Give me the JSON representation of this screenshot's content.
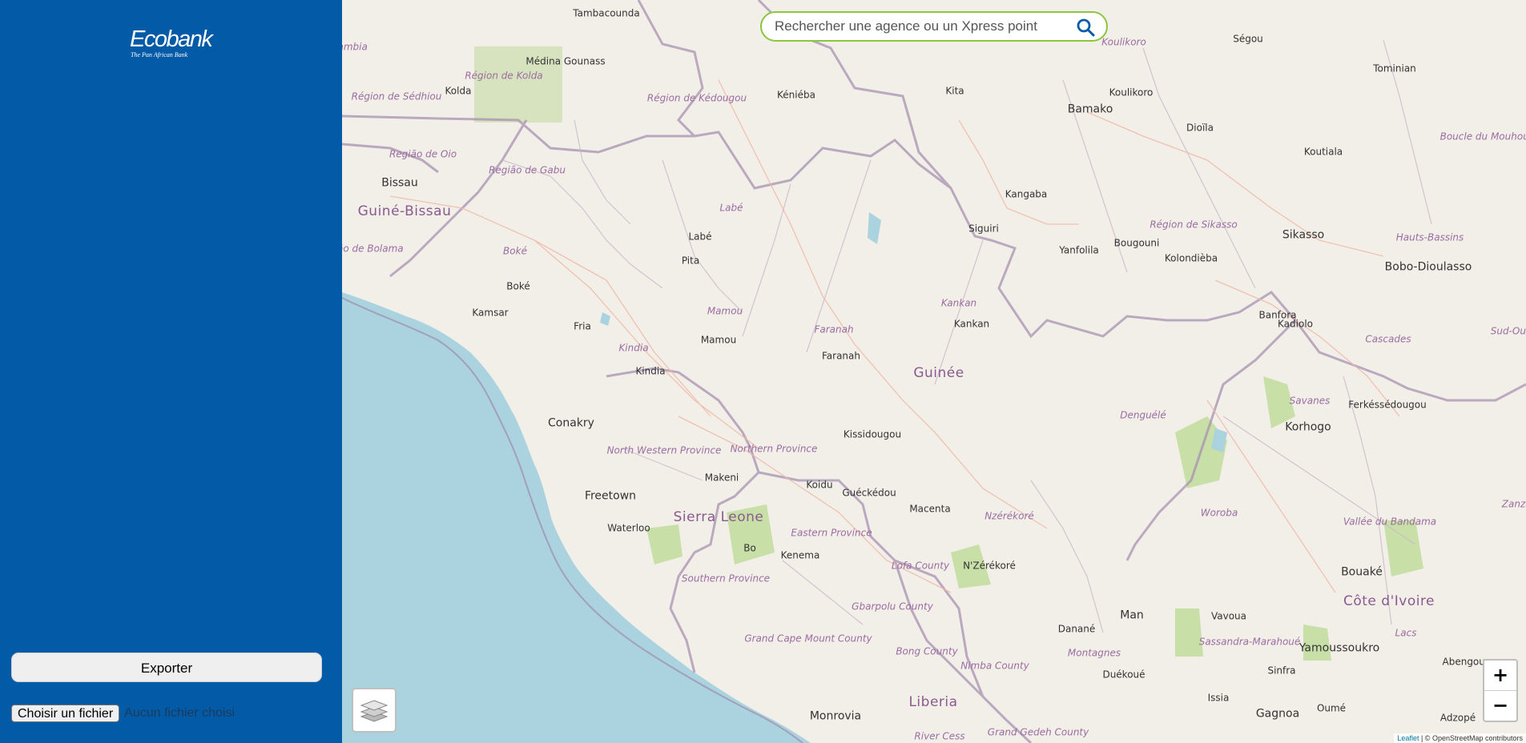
{
  "sidebar": {
    "logo_name": "Ecobank",
    "logo_tagline": "The Pan African Bank",
    "export_label": "Exporter",
    "file_button_label": "Choisir un fichier",
    "file_status": "Aucun fichier choisi"
  },
  "search": {
    "placeholder": "Rechercher une agence ou un Xpress point"
  },
  "map": {
    "zoom_in": "+",
    "zoom_out": "−",
    "attribution_link": "Leaflet",
    "attribution_text": "| © OpenStreetMap contributors",
    "countries": [
      "Guinée",
      "Sierra Leone",
      "Liberia",
      "Côte d'Ivoire",
      "Guiné-Bissau"
    ],
    "capitals": [
      "Bissau",
      "Conakry",
      "Freetown",
      "Monrovia",
      "Bamako",
      "Yamoussoukro"
    ],
    "cities": [
      "Tambacounda",
      "Médina Gounass",
      "Kolda",
      "Kéniéba",
      "Kita",
      "Ségou",
      "Koulikoro",
      "Tominian",
      "Dioïla",
      "Koutiala",
      "Kangaba",
      "Siguiri",
      "Bougouni",
      "Yanfolila",
      "Kolondièba",
      "Sikasso",
      "Bobo-Dioulasso",
      "Labé",
      "Pita",
      "Boké",
      "Kamsar",
      "Fria",
      "Mamou",
      "Kindia",
      "Faranah",
      "Kankan",
      "Banfora",
      "Kadiolo",
      "Ferkéssédougou",
      "Korhogo",
      "Kissidougou",
      "Makeni",
      "Koidu",
      "Guéckédou",
      "Macenta",
      "Waterloo",
      "Bo",
      "Kenema",
      "N'Zérékoré",
      "Man",
      "Danané",
      "Duékoué",
      "Vavoua",
      "Bouaké",
      "Sinfra",
      "Issia",
      "Gagnoa",
      "Oumé",
      "Adzopé",
      "Abengourou"
    ],
    "regions": [
      "Région de Sédhiou",
      "Région de Kolda",
      "Région de Kédougou",
      "Região de Oio",
      "Região de Gabu",
      "Região de Bolama",
      "Labé",
      "Boké",
      "Mamou",
      "Kindia",
      "Faranah",
      "Kankan",
      "Koulikoro",
      "Région de Sikasso",
      "Hauts-Bassins",
      "Boucle du Mouhoun",
      "Cascades",
      "Sud-Ouest",
      "Savanes",
      "Denguélé",
      "Woroba",
      "Vallée du Bandama",
      "Zanzan",
      "North Western Province",
      "Northern Province",
      "Eastern Province",
      "Southern Province",
      "Lofa County",
      "Gbarpolu County",
      "Grand Cape Mount County",
      "Bong County",
      "Nimba County",
      "Grand Gedeh County",
      "River Cess",
      "Nzérékoré",
      "Montagnes",
      "Sassandra-Marahoué",
      "Lacs",
      "Mambia"
    ]
  }
}
